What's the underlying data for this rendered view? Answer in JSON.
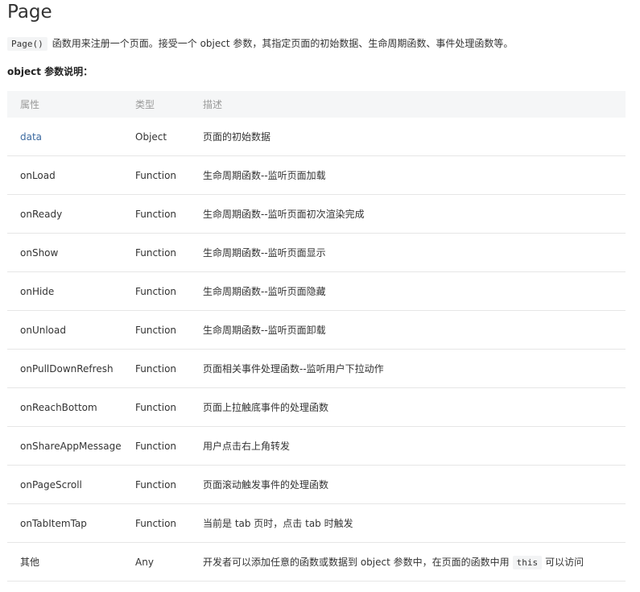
{
  "title": "Page",
  "intro": {
    "code": "Page()",
    "text": "函数用来注册一个页面。接受一个 object 参数，其指定页面的初始数据、生命周期函数、事件处理函数等。"
  },
  "subheading": "object 参数说明：",
  "table": {
    "headers": [
      "属性",
      "类型",
      "描述"
    ],
    "rows": [
      {
        "name": "data",
        "type": "Object",
        "desc": "页面的初始数据"
      },
      {
        "name": "onLoad",
        "type": "Function",
        "desc": "生命周期函数--监听页面加载"
      },
      {
        "name": "onReady",
        "type": "Function",
        "desc": "生命周期函数--监听页面初次渲染完成"
      },
      {
        "name": "onShow",
        "type": "Function",
        "desc": "生命周期函数--监听页面显示"
      },
      {
        "name": "onHide",
        "type": "Function",
        "desc": "生命周期函数--监听页面隐藏"
      },
      {
        "name": "onUnload",
        "type": "Function",
        "desc": "生命周期函数--监听页面卸载"
      },
      {
        "name": "onPullDownRefresh",
        "type": "Function",
        "desc": "页面相关事件处理函数--监听用户下拉动作"
      },
      {
        "name": "onReachBottom",
        "type": "Function",
        "desc": "页面上拉触底事件的处理函数"
      },
      {
        "name": "onShareAppMessage",
        "type": "Function",
        "desc": "用户点击右上角转发"
      },
      {
        "name": "onPageScroll",
        "type": "Function",
        "desc": "页面滚动触发事件的处理函数"
      },
      {
        "name": "onTabItemTap",
        "type": "Function",
        "desc": "当前是 tab 页时，点击 tab 时触发"
      },
      {
        "name": "其他",
        "type": "Any",
        "desc_before": "开发者可以添加任意的函数或数据到 object 参数中，在页面的函数中用",
        "desc_code": "this",
        "desc_after": "可以访问"
      }
    ]
  },
  "colors": {
    "link": "#3c6aa0",
    "header_bg": "#f5f6f7",
    "border": "#e6e6e6"
  }
}
